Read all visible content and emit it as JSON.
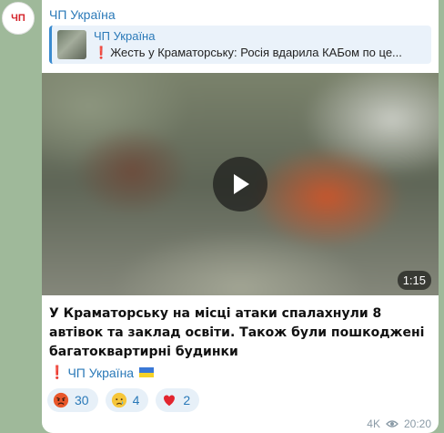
{
  "channel": {
    "avatar_text": "ЧП",
    "name": "ЧП Україна"
  },
  "reply": {
    "title": "ЧП Україна",
    "excl": "❗",
    "text": "Жесть у Краматорську: Росія вдарила КАБом по це..."
  },
  "video": {
    "duration": "1:15"
  },
  "message": {
    "text": "У Краматорську на місці атаки спалахнули 8 автівок та заклад освіти. Також були пошкоджені багатоквартирні будинки"
  },
  "signature": {
    "excl": "❗",
    "text": "ЧП Україна"
  },
  "reactions": [
    {
      "emoji": "angry-face-icon",
      "count": "30"
    },
    {
      "emoji": "crying-face-icon",
      "count": "4"
    },
    {
      "emoji": "red-heart-icon",
      "count": "2"
    }
  ],
  "meta": {
    "views": "4K",
    "time": "20:20"
  },
  "colors": {
    "accent": "#2a79b8",
    "alert": "#d4232a",
    "background": "#9fb99a"
  }
}
